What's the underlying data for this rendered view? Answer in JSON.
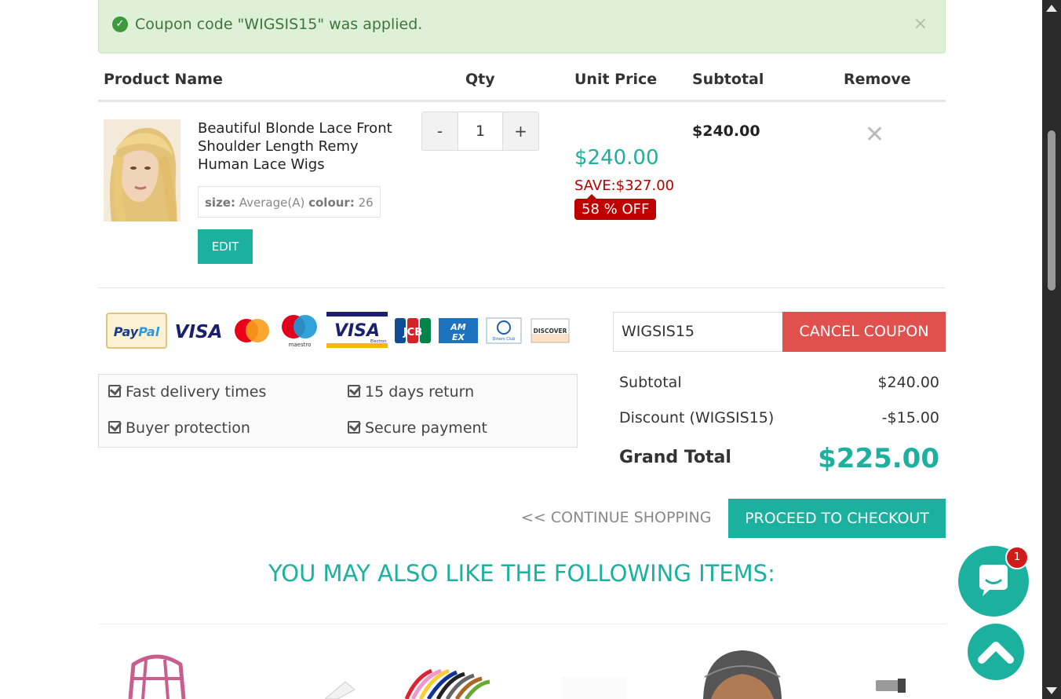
{
  "alert": {
    "message": "Coupon code \"WIGSIS15\" was applied.",
    "close": "×"
  },
  "table_headers": {
    "product_name": "Product Name",
    "qty": "Qty",
    "unit_price": "Unit Price",
    "subtotal": "Subtotal",
    "remove": "Remove"
  },
  "cart_item": {
    "name": "Beautiful Blonde Lace Front Shoulder Length Remy Human Lace Wigs",
    "size_label": "size:",
    "size_value": "Average(A)",
    "colour_label": "colour:",
    "colour_value": "26",
    "edit_label": "EDIT",
    "qty_minus": "-",
    "qty_value": "1",
    "qty_plus": "+",
    "unit_price": "$240.00",
    "save_text": "SAVE:$327.00",
    "off_badge": "58 % OFF",
    "subtotal": "$240.00"
  },
  "payment_logos": [
    "PayPal",
    "VISA",
    "mastercard",
    "maestro",
    "VISA Electron",
    "JCB",
    "AMEX",
    "Diners Club",
    "DISCOVER"
  ],
  "features": [
    "Fast delivery times",
    "15 days return",
    "Buyer protection",
    "Secure payment"
  ],
  "coupon": {
    "value": "WIGSIS15",
    "cancel_label": "CANCEL COUPON"
  },
  "summary": {
    "subtotal_label": "Subtotal",
    "subtotal_value": "$240.00",
    "discount_label": "Discount (WIGSIS15)",
    "discount_value": "-$15.00",
    "grand_label": "Grand Total",
    "grand_value": "$225.00"
  },
  "actions": {
    "continue": "<< CONTINUE SHOPPING",
    "checkout": "PROCEED TO CHECKOUT"
  },
  "recommend_title": "YOU MAY ALSO LIKE THE FOLLOWING ITEMS:",
  "chat": {
    "badge": "1"
  },
  "colors": {
    "accent": "#1bb19e",
    "danger": "#e0504d",
    "sale_red": "#c00000",
    "alert_bg": "#dff0d8"
  }
}
